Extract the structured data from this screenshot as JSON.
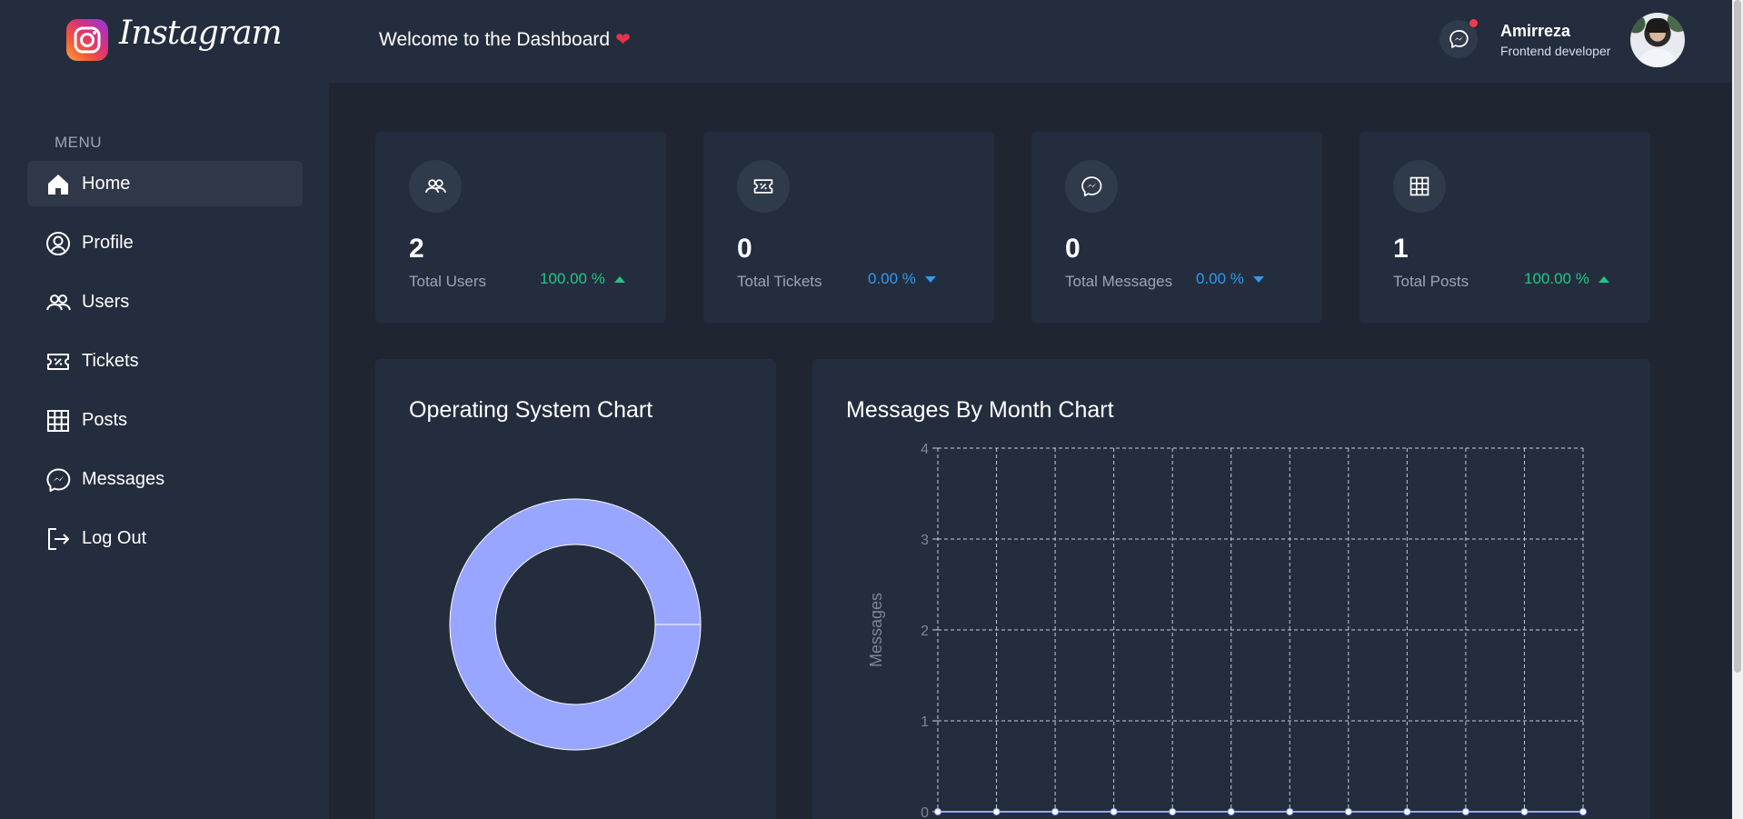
{
  "header": {
    "brand": "Instagram",
    "welcome": "Welcome to the Dashboard",
    "heart": "❤",
    "user": {
      "name": "Amirreza",
      "role": "Frontend developer"
    }
  },
  "sidebar": {
    "menu_title": "MENU",
    "items": [
      {
        "label": "Home",
        "icon": "home-icon",
        "active": true
      },
      {
        "label": "Profile",
        "icon": "user-circle-icon"
      },
      {
        "label": "Users",
        "icon": "users-icon"
      },
      {
        "label": "Tickets",
        "icon": "ticket-icon"
      },
      {
        "label": "Posts",
        "icon": "grid-icon"
      },
      {
        "label": "Messages",
        "icon": "messenger-icon"
      },
      {
        "label": "Log Out",
        "icon": "logout-icon"
      }
    ]
  },
  "cards": [
    {
      "value": "2",
      "label": "Total Users",
      "pct": "100.00 %",
      "trend": "up",
      "icon": "users-icon"
    },
    {
      "value": "0",
      "label": "Total Tickets",
      "pct": "0.00 %",
      "trend": "down",
      "icon": "ticket-icon"
    },
    {
      "value": "0",
      "label": "Total Messages",
      "pct": "0.00 %",
      "trend": "down",
      "icon": "messenger-icon"
    },
    {
      "value": "1",
      "label": "Total Posts",
      "pct": "100.00 %",
      "trend": "up",
      "icon": "grid-icon"
    }
  ],
  "colors": {
    "accent_up": "#22c58a",
    "accent_down": "#2d9bf0",
    "chart_fill": "#98a6ff",
    "background": "#1f2631",
    "panel": "#232d3d"
  },
  "chart_data": [
    {
      "type": "pie",
      "title": "Operating System Chart",
      "slices": [
        {
          "value": 100
        }
      ]
    },
    {
      "type": "line",
      "title": "Messages By Month Chart",
      "ylabel": "Messages",
      "ylim": [
        0,
        4
      ],
      "yticks": [
        "0",
        "1",
        "2",
        "3",
        "4"
      ],
      "series": [
        {
          "values": [
            0,
            0,
            0,
            0,
            0,
            0,
            0,
            0,
            0,
            0,
            0,
            0
          ]
        }
      ],
      "grid": true
    }
  ]
}
